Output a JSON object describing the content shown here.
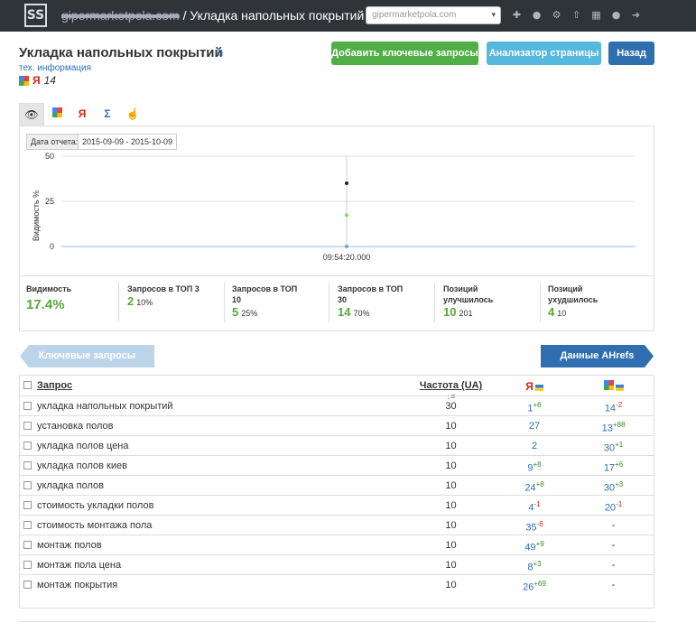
{
  "header": {
    "logo": "SS",
    "site_blurred": "gipermarketpola.com",
    "title_suffix": "/ Укладка напольных покрытий",
    "site_select": "gipermarketpola.com"
  },
  "page": {
    "title": "Укладка напольных покрытий",
    "tech_link": "тех. информация",
    "index_count": "14"
  },
  "actions": {
    "add_keywords": "Добавить ключевые запросы",
    "analyzer": "Анализатор страницы",
    "back": "Назад"
  },
  "report": {
    "date_label": "Дата отчета:",
    "date_value": "2015-09-09 - 2015-10-09"
  },
  "chart_data": {
    "type": "scatter",
    "ylabel": "Видимость %",
    "ylim": [
      0,
      50
    ],
    "yticks": [
      "50",
      "25",
      "0"
    ],
    "xtick": "09:54:20.000",
    "series": [
      {
        "color": "#222222",
        "values": [
          35
        ]
      },
      {
        "color": "#8fd46a",
        "values": [
          17.4
        ]
      },
      {
        "color": "#6aa5e0",
        "values": [
          0
        ]
      }
    ]
  },
  "stats": [
    {
      "label": "Видимость",
      "value": "17.4%",
      "pct": ""
    },
    {
      "label": "Запросов в ТОП 3",
      "value": "2",
      "pct": "10%"
    },
    {
      "label": "Запросов в ТОП 10",
      "value": "5",
      "pct": "25%"
    },
    {
      "label": "Запросов в ТОП 30",
      "value": "14",
      "pct": "70%"
    },
    {
      "label": "Позиций улучшилось",
      "value": "10",
      "pct": "201"
    },
    {
      "label": "Позиций ухудшилось",
      "value": "4",
      "pct": "10"
    }
  ],
  "nav": {
    "keywords": "Ключевые запросы",
    "ahrefs": "Данные AHrefs"
  },
  "table": {
    "col_query": "Запрос",
    "col_freq": "Частота (UA)",
    "col_yandex": "Я",
    "rows": [
      {
        "query": "укладка напольных покрытий",
        "freq": "30",
        "y": "1",
        "y_delta": "+6",
        "g": "14",
        "g_delta": "-2"
      },
      {
        "query": "установка полов",
        "freq": "10",
        "y": "27",
        "y_delta": "",
        "g": "13",
        "g_delta": "+88"
      },
      {
        "query": "укладка полов цена",
        "freq": "10",
        "y": "2",
        "y_delta": "",
        "g": "30",
        "g_delta": "+1"
      },
      {
        "query": "укладка полов киев",
        "freq": "10",
        "y": "9",
        "y_delta": "+8",
        "g": "17",
        "g_delta": "+6"
      },
      {
        "query": "укладка полов",
        "freq": "10",
        "y": "24",
        "y_delta": "+8",
        "g": "30",
        "g_delta": "+3"
      },
      {
        "query": "стоимость укладки полов",
        "freq": "10",
        "y": "4",
        "y_delta": "-1",
        "g": "20",
        "g_delta": "-1"
      },
      {
        "query": "стоимость монтажа пола",
        "freq": "10",
        "y": "35",
        "y_delta": "-6",
        "g": "-",
        "g_delta": ""
      },
      {
        "query": "монтаж полов",
        "freq": "10",
        "y": "49",
        "y_delta": "+9",
        "g": "-",
        "g_delta": ""
      },
      {
        "query": "монтаж пола цена",
        "freq": "10",
        "y": "8",
        "y_delta": "+3",
        "g": "-",
        "g_delta": ""
      },
      {
        "query": "монтаж покрытия",
        "freq": "10",
        "y": "26",
        "y_delta": "+69",
        "g": "-",
        "g_delta": ""
      }
    ]
  }
}
